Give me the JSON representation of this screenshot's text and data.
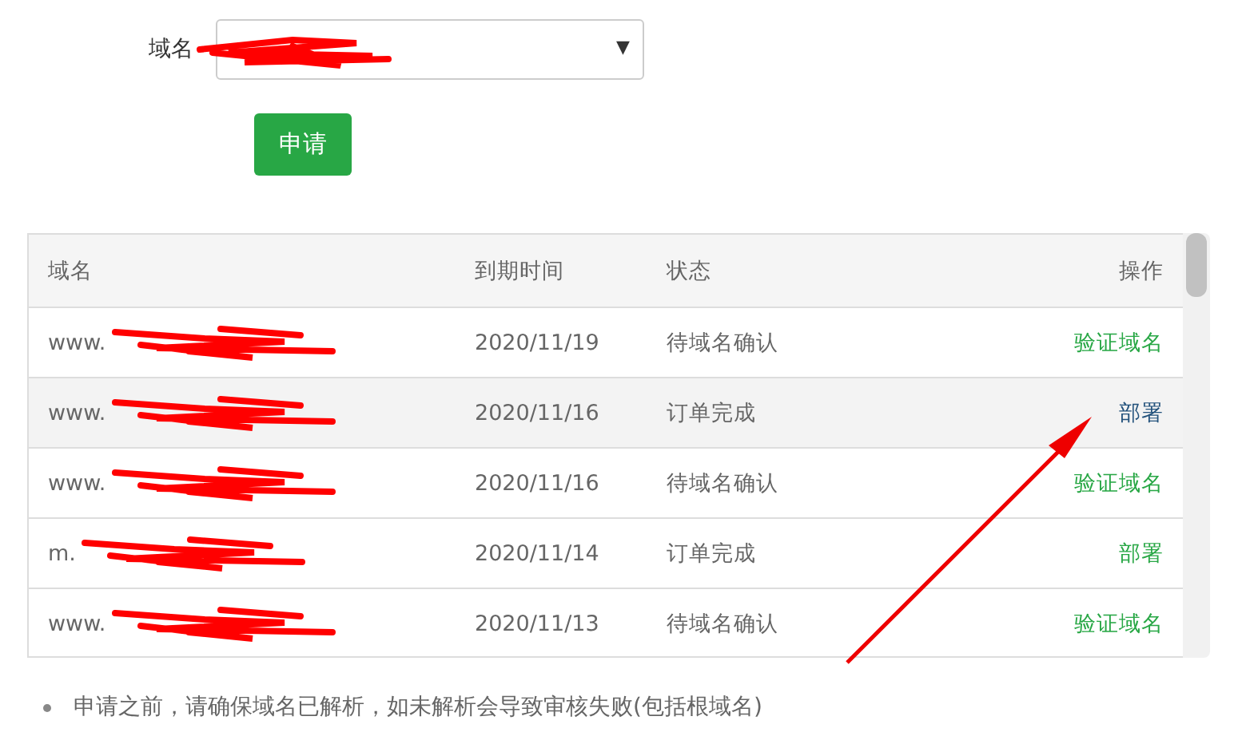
{
  "form": {
    "label": "域名",
    "select_arrow": "▼",
    "submit": "申请"
  },
  "table": {
    "columns": [
      "域名",
      "到期时间",
      "状态",
      "操作"
    ],
    "rows": [
      {
        "domain": "www.",
        "expires": "2020/11/19",
        "status": "待域名确认",
        "action": "验证域名",
        "highlighted": false
      },
      {
        "domain": "www.",
        "expires": "2020/11/16",
        "status": "订单完成",
        "action": "部署",
        "highlighted": true
      },
      {
        "domain": "www.",
        "expires": "2020/11/16",
        "status": "待域名确认",
        "action": "验证域名",
        "highlighted": false
      },
      {
        "domain": "m.",
        "expires": "2020/11/14",
        "status": "订单完成",
        "action": "部署",
        "highlighted": false
      },
      {
        "domain": "www.",
        "expires": "2020/11/13",
        "status": "待域名确认",
        "action": "验证域名",
        "highlighted": false
      }
    ]
  },
  "notes": [
    "申请之前，请确保域名已解析，如未解析会导致审核失败(包括根域名)"
  ]
}
